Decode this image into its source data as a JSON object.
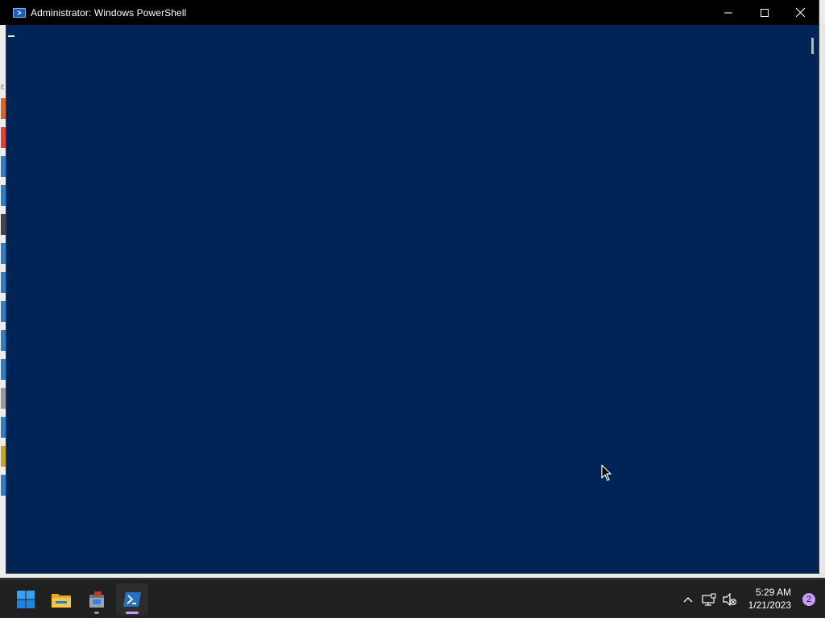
{
  "window": {
    "title": "Administrator: Windows PowerShell",
    "console_bg": "#012456",
    "controls": {
      "minimize_icon": "minimize-icon",
      "maximize_icon": "maximize-icon",
      "close_icon": "close-icon"
    }
  },
  "taskbar": {
    "items": [
      {
        "name": "start",
        "icon": "windows-logo-icon"
      },
      {
        "name": "file-explorer",
        "icon": "folder-icon"
      },
      {
        "name": "server-manager",
        "icon": "toolbox-icon"
      },
      {
        "name": "powershell",
        "icon": "powershell-icon",
        "active": true
      }
    ],
    "tray": {
      "overflow_icon": "chevron-up-icon",
      "network_icon": "network-icon",
      "volume_icon": "volume-muted-icon"
    },
    "clock": {
      "time": "5:29 AM",
      "date": "1/21/2023"
    },
    "notification_count": "2",
    "accent": "#c89bff"
  }
}
